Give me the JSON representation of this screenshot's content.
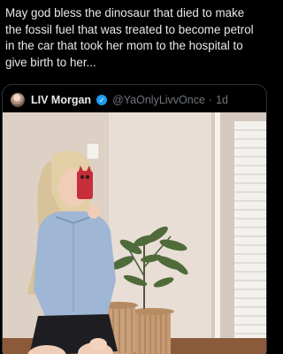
{
  "post": {
    "text": "May god bless the dinosaur that died to make the fossil fuel that was treated to become petrol in the car that took her mom to the hospital to give birth to her..."
  },
  "quoted_post": {
    "display_name": "LIV Morgan",
    "verified": true,
    "handle": "@YaOnlyLivvOnce",
    "separator": "·",
    "time": "1d",
    "image_description_icon": "photo-of-woman-with-plant"
  },
  "colors": {
    "background": "#000000",
    "text_primary": "#e7e9ea",
    "text_secondary": "#71767b",
    "verified_blue": "#1d9bf0",
    "card_border": "#2f3336"
  }
}
